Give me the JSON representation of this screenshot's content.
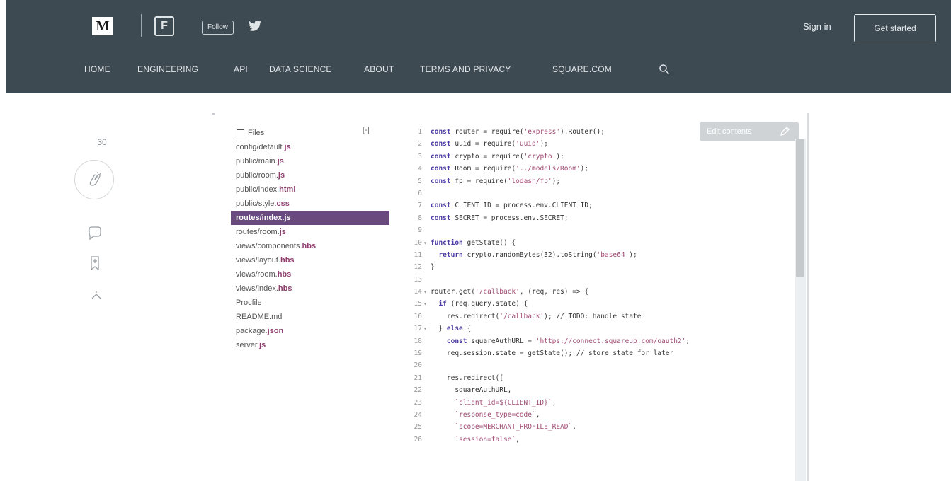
{
  "header": {
    "logo_letter": "M",
    "publication_icon_letter": "F",
    "follow_label": "Follow",
    "sign_in": "Sign in",
    "get_started": "Get started",
    "nav": [
      "HOME",
      "ENGINEERING",
      "API",
      "DATA SCIENCE",
      "ABOUT",
      "TERMS AND PRIVACY",
      "SQUARE.COM"
    ]
  },
  "rail": {
    "clap_count": "30"
  },
  "embed": {
    "files_label": "Files",
    "collapse_label": "[-]",
    "files": [
      {
        "name": "config/default.",
        "ext": "js"
      },
      {
        "name": "public/main.",
        "ext": "js"
      },
      {
        "name": "public/room.",
        "ext": "js"
      },
      {
        "name": "public/index.",
        "ext": "html"
      },
      {
        "name": "public/style.",
        "ext": "css"
      },
      {
        "name": "routes/index.",
        "ext": "js"
      },
      {
        "name": "routes/room.",
        "ext": "js"
      },
      {
        "name": "views/components.",
        "ext": "hbs"
      },
      {
        "name": "views/layout.",
        "ext": "hbs"
      },
      {
        "name": "views/room.",
        "ext": "hbs"
      },
      {
        "name": "views/index.",
        "ext": "hbs"
      },
      {
        "name": "Procfile",
        "ext": ""
      },
      {
        "name": "README.md",
        "ext": ""
      },
      {
        "name": "package.",
        "ext": "json"
      },
      {
        "name": "server.",
        "ext": "js"
      }
    ],
    "selected_file_index": 5,
    "edit_button_label": "Edit contents",
    "code_lines": [
      {
        "n": "1",
        "t": "const router = require('express').Router();"
      },
      {
        "n": "2",
        "t": "const uuid = require('uuid');"
      },
      {
        "n": "3",
        "t": "const crypto = require('crypto');"
      },
      {
        "n": "4",
        "t": "const Room = require('../models/Room');"
      },
      {
        "n": "5",
        "t": "const fp = require('lodash/fp');"
      },
      {
        "n": "6",
        "t": ""
      },
      {
        "n": "7",
        "t": "const CLIENT_ID = process.env.CLIENT_ID;"
      },
      {
        "n": "8",
        "t": "const SECRET = process.env.SECRET;"
      },
      {
        "n": "9",
        "t": ""
      },
      {
        "n": "10",
        "t": "function getState() {",
        "fold": true
      },
      {
        "n": "11",
        "t": "  return crypto.randomBytes(32).toString('base64');"
      },
      {
        "n": "12",
        "t": "}"
      },
      {
        "n": "13",
        "t": ""
      },
      {
        "n": "14",
        "t": "router.get('/callback', (req, res) => {",
        "fold": true
      },
      {
        "n": "15",
        "t": "  if (req.query.state) {",
        "fold": true
      },
      {
        "n": "16",
        "t": "    res.redirect('/callback'); // TODO: handle state"
      },
      {
        "n": "17",
        "t": "  } else {",
        "fold": true
      },
      {
        "n": "18",
        "t": "    const squareAuthURL = 'https://connect.squareup.com/oauth2';"
      },
      {
        "n": "19",
        "t": "    req.session.state = getState(); // store state for later"
      },
      {
        "n": "20",
        "t": ""
      },
      {
        "n": "21",
        "t": "    res.redirect(["
      },
      {
        "n": "22",
        "t": "      squareAuthURL,"
      },
      {
        "n": "23",
        "t": "      `client_id=${CLIENT_ID}`,"
      },
      {
        "n": "24",
        "t": "      `response_type=code`,"
      },
      {
        "n": "25",
        "t": "      `scope=MERCHANT_PROFILE_READ`,"
      },
      {
        "n": "26",
        "t": "      `session=false`,"
      }
    ]
  },
  "colors": {
    "header_bg": "#3e4a52",
    "selected_file_bg": "#6a4a7e",
    "keyword": "#4b3ba6",
    "string": "#a04b74"
  }
}
